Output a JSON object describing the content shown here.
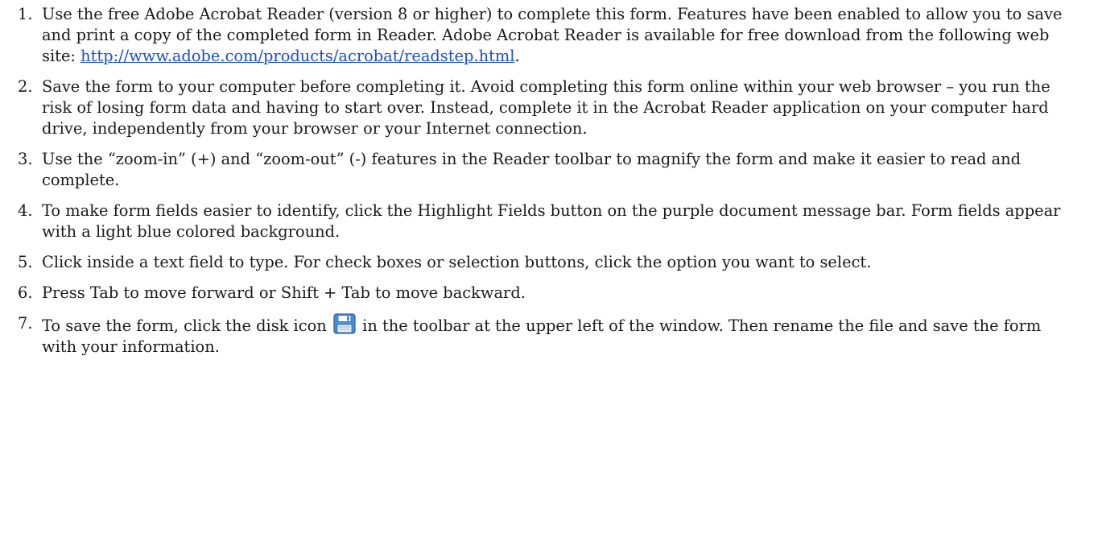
{
  "steps": [
    {
      "number": "1.",
      "text": "Use the free Adobe Acrobat Reader (version 8 or higher) to complete this form.  Features have been enabled to allow you to save and print a copy of the completed form in Reader.  Adobe Acrobat Reader is available for free download from the following web site: ",
      "link": "http://www.adobe.com/products/acrobat/readstep.html",
      "after": "."
    },
    {
      "number": "2.",
      "text": "Save the form to your computer before completing it.  Avoid completing this form online within your web browser – you run the risk of losing form data and having to start over.  Instead, complete it in the Acrobat Reader application on your computer hard drive, independently from your browser or your Internet connection."
    },
    {
      "number": "3.",
      "text": "Use the “zoom-in” (+) and “zoom-out” (-) features in the Reader toolbar to magnify the form and make it easier to read and complete."
    },
    {
      "number": "4.",
      "text": "To make form fields easier to identify, click the Highlight Fields button  on the purple document message bar. Form fields appear with a light blue colored background."
    },
    {
      "number": "5.",
      "text": "Click inside a text field to type. For check boxes or selection buttons, click the option you want to select."
    },
    {
      "number": "6.",
      "text": "Press Tab to move forward or Shift + Tab to move backward."
    },
    {
      "number": "7.",
      "text_before": "To save the form, click the disk icon ",
      "icon": "disk-icon",
      "text_after": " in the toolbar at the upper left of the window. Then rename the file and save the form with your information."
    }
  ],
  "colors": {
    "text": "#1a1a1a",
    "link": "#1a4fc9",
    "disk_icon_body": "#4a90d9",
    "disk_icon_label": "#e8eef5"
  }
}
